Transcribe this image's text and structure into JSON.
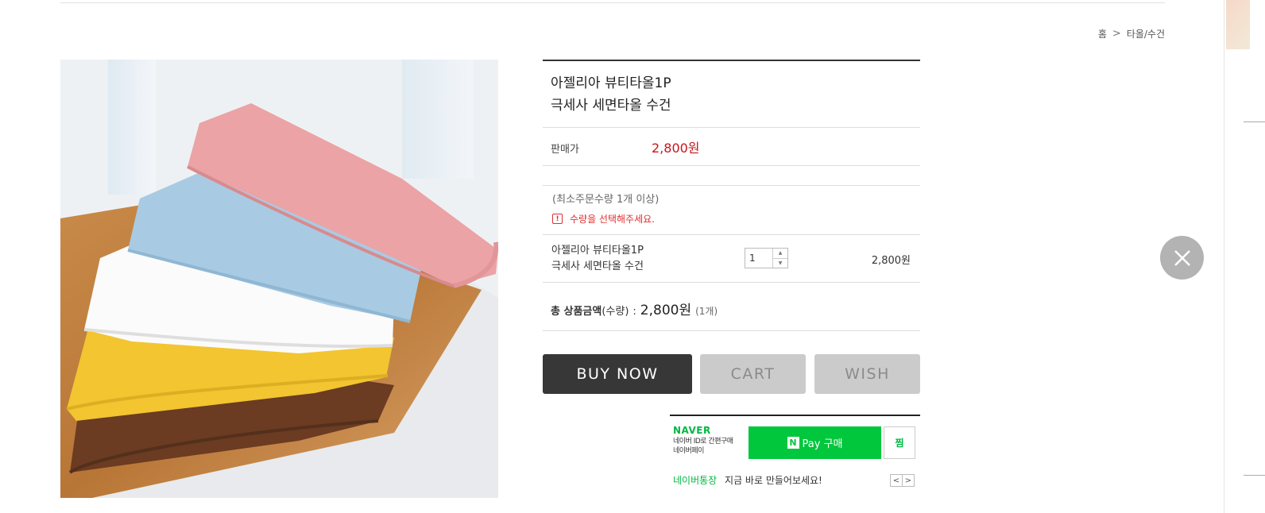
{
  "breadcrumb": {
    "home": "홈",
    "separator": ">",
    "category": "타올/수건"
  },
  "product": {
    "title_line1": "아젤리아 뷰티타올1P",
    "title_line2": "극세사 세면타올 수건",
    "price_label": "판매가",
    "price": "2,800원",
    "image_icon": "towel-stack-photo"
  },
  "order": {
    "min_qty_note": "(최소주문수량 1개 이상)",
    "warning": "수량을 선택해주세요.",
    "warning_icon": "!",
    "option_name_line1": "아젤리아 뷰티타올1P",
    "option_name_line2": "극세사 세면타올 수건",
    "quantity": "1",
    "stepper_up": "▲",
    "stepper_down": "▼",
    "option_price": "2,800원",
    "total_label": "총 상품금액",
    "total_sub": "(수량)",
    "total_colon": ":",
    "total_amount": "2,800원",
    "total_count": "(1개)"
  },
  "buttons": {
    "buy": "BUY NOW",
    "cart": "CART",
    "wish": "WISH"
  },
  "npay": {
    "brand": "NAVER",
    "sub_line1": "네이버 ID로 간편구매",
    "sub_line2": "네이버페이",
    "n_logo": "N",
    "pay_label": "Pay 구매",
    "zzim_label": "찜",
    "promo_highlight": "네이버통장",
    "promo_text": "지금 바로 만들어보세요!",
    "prev": "<",
    "next": ">"
  },
  "colors": {
    "price_red": "#c4161c",
    "buy_dark": "#373737",
    "naver_green": "#00c73c",
    "button_gray": "#cbcbcb"
  }
}
